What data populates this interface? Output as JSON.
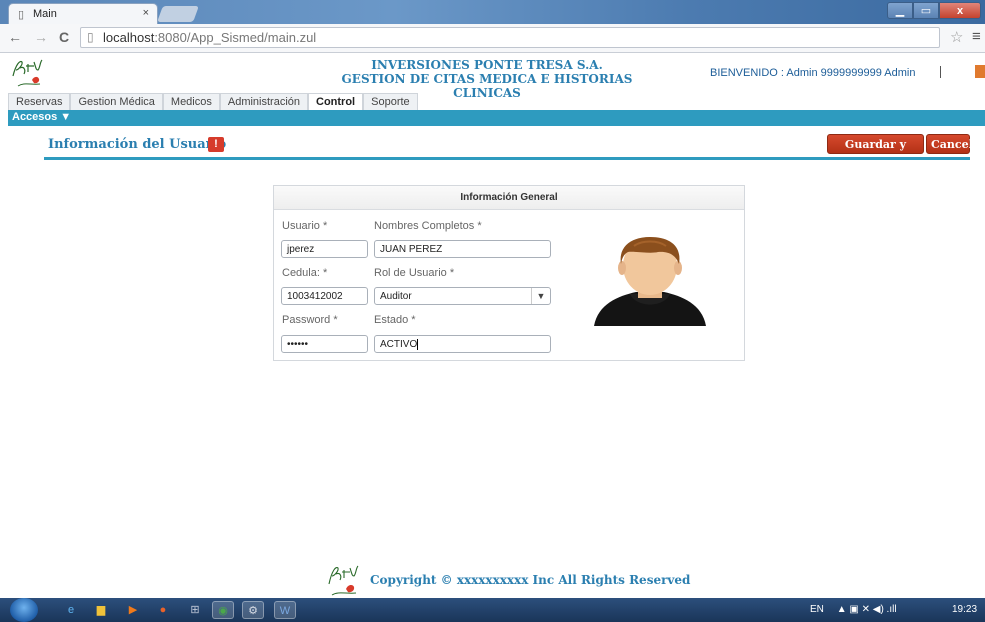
{
  "browser": {
    "tab_title": "Main",
    "tab_close": "×",
    "url_host": "localhost",
    "url_path": ":8080/App_Sismed/main.zul",
    "back_icon": "←",
    "forward_icon": "→",
    "reload_icon": "C",
    "star_icon": "☆",
    "menu_icon": "≡"
  },
  "header": {
    "company_line1": "INVERSIONES PONTE TRESA S.A.",
    "company_line2": "GESTION DE CITAS MEDICA E HISTORIAS CLINICAS",
    "welcome": "BIENVENIDO : Admin 9999999999 Admin"
  },
  "tabs": [
    {
      "label": "Reservas"
    },
    {
      "label": "Gestion Médica"
    },
    {
      "label": "Medicos"
    },
    {
      "label": "Administración"
    },
    {
      "label": "Control"
    },
    {
      "label": "Soporte"
    }
  ],
  "active_tab": "Control",
  "accesos": "Accesos ▼",
  "form": {
    "title": "Información del Usuario",
    "warn": "!",
    "save_button": "Guardar y Cerrar",
    "cancel_button": "Cancel",
    "panel_title": "Información General",
    "usuario_label": "Usuario *",
    "usuario_value": "jperez",
    "nombres_label": "Nombres Completos *",
    "nombres_value": "JUAN PEREZ",
    "cedula_label": "Cedula: *",
    "cedula_value": "1003412002",
    "rol_label": "Rol de Usuario *",
    "rol_value": "Auditor",
    "password_label": "Password *",
    "password_value": "••••••",
    "estado_label": "Estado *",
    "estado_value": "ACTIVO"
  },
  "footer": {
    "copyright": "Copyright © xxxxxxxxxx Inc All Rights Reserved"
  },
  "taskbar": {
    "lang": "EN",
    "time": "19:23"
  },
  "colors": {
    "accent_blue": "#2b7fb0",
    "bar_teal": "#2e9bbf",
    "button_red": "#c23a1f"
  }
}
